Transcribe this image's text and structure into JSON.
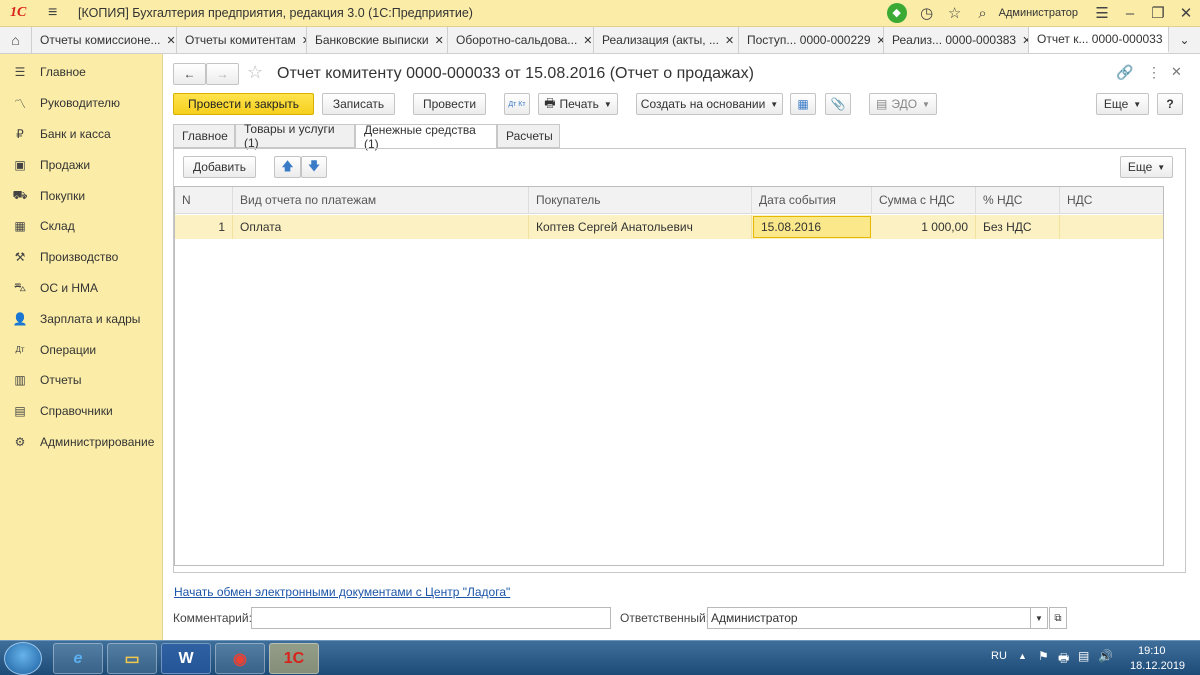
{
  "window": {
    "logo": "1С",
    "title": "[КОПИЯ] Бухгалтерия предприятия, редакция 3.0  (1С:Предприятие)",
    "user": "Администратор"
  },
  "tabs": [
    {
      "label": "Отчеты комиссионе..."
    },
    {
      "label": "Отчеты комитентам"
    },
    {
      "label": "Банковские выписки"
    },
    {
      "label": "Оборотно-сальдова..."
    },
    {
      "label": "Реализация (акты, ..."
    },
    {
      "label": "Поступ... 0000-000229"
    },
    {
      "label": "Реализ... 0000-000383"
    },
    {
      "label": "Отчет к... 0000-000033"
    }
  ],
  "sidebar": {
    "items": [
      {
        "label": "Главное",
        "icon": "☰"
      },
      {
        "label": "Руководителю",
        "icon": "〽"
      },
      {
        "label": "Банк и касса",
        "icon": "₽"
      },
      {
        "label": "Продажи",
        "icon": "▣"
      },
      {
        "label": "Покупки",
        "icon": "⛟"
      },
      {
        "label": "Склад",
        "icon": "▦"
      },
      {
        "label": "Производство",
        "icon": "⚒"
      },
      {
        "label": "ОС и НМА",
        "icon": "⛍"
      },
      {
        "label": "Зарплата и кадры",
        "icon": "👤"
      },
      {
        "label": "Операции",
        "icon": "Дт"
      },
      {
        "label": "Отчеты",
        "icon": "▥"
      },
      {
        "label": "Справочники",
        "icon": "▤"
      },
      {
        "label": "Администрирование",
        "icon": "⚙"
      }
    ]
  },
  "document": {
    "title": "Отчет комитенту 0000-000033 от 15.08.2016 (Отчет о продажах)"
  },
  "toolbar": {
    "post_close": "Провести и закрыть",
    "save": "Записать",
    "post": "Провести",
    "dtkt": "Дт Кт",
    "print": "Печать",
    "create_based": "Создать на основании",
    "edo": "ЭДО",
    "more": "Еще",
    "help": "?"
  },
  "subtabs": [
    {
      "label": "Главное"
    },
    {
      "label": "Товары и услуги (1)"
    },
    {
      "label": "Денежные средства (1)"
    },
    {
      "label": "Расчеты"
    }
  ],
  "grid_toolbar": {
    "add": "Добавить",
    "more": "Еще"
  },
  "grid": {
    "headers": [
      "N",
      "Вид отчета по платежам",
      "Покупатель",
      "Дата события",
      "Сумма с НДС",
      "% НДС",
      "НДС"
    ],
    "rows": [
      [
        "1",
        "Оплата",
        "Коптев Сергей Анатольевич",
        "15.08.2016",
        "1 000,00",
        "Без НДС",
        ""
      ]
    ]
  },
  "footer": {
    "edo_link": "Начать обмен электронными документами с Центр \"Ладога\"",
    "comment_label": "Комментарий:",
    "comment_value": "",
    "responsible_label": "Ответственный:",
    "responsible_value": "Администратор"
  },
  "taskbar": {
    "lang": "RU",
    "time": "19:10",
    "date": "18.12.2019"
  },
  "colors": {
    "accent": "#fbeda8",
    "primary_button": "#f6cf1e",
    "selected_row": "#fbf1c2",
    "link": "#1c55a8"
  }
}
